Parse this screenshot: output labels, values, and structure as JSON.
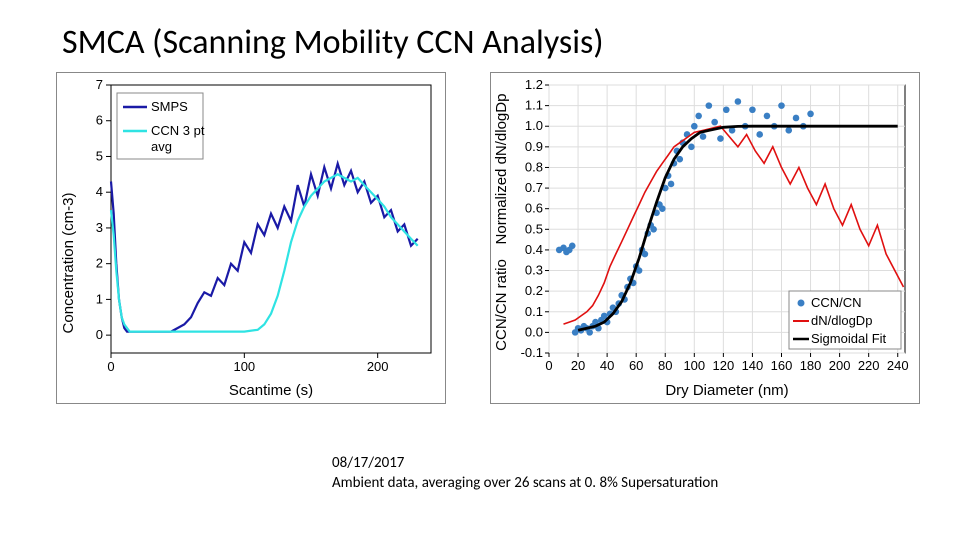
{
  "page_title": "SMCA (Scanning Mobility CCN Analysis)",
  "caption_line1": "08/17/2017",
  "caption_line2": "Ambient data, averaging over 26 scans at 0. 8% Supersaturation",
  "left_chart": {
    "xlabel": "Scantime (s)",
    "ylabel": "Concentration (cm-3)",
    "legend": {
      "s1": "SMPS",
      "s2": "CCN 3 pt",
      "s3": "avg"
    }
  },
  "right_chart": {
    "xlabel": "Dry Diameter (nm)",
    "ylabel_top": "Normalized dN/dlogDp",
    "ylabel_bot": "CCN/CN ratio",
    "legend": {
      "s1": "CCN/CN",
      "s2": "dN/dlogDp",
      "s3": "Sigmoidal Fit"
    }
  },
  "chart_data": [
    {
      "type": "line",
      "title": "",
      "xlabel": "Scantime (s)",
      "ylabel": "Concentration (cm-3)",
      "xlim": [
        0,
        240
      ],
      "ylim": [
        -0.5,
        7
      ],
      "xticks": [
        0,
        100,
        200
      ],
      "yticks": [
        0,
        1,
        2,
        3,
        4,
        5,
        6,
        7
      ],
      "series": [
        {
          "name": "SMPS",
          "color": "#1a1aa6",
          "x": [
            0,
            2,
            4,
            6,
            8,
            10,
            12,
            14,
            16,
            18,
            20,
            25,
            30,
            35,
            40,
            45,
            50,
            55,
            60,
            65,
            70,
            75,
            80,
            85,
            90,
            95,
            100,
            105,
            110,
            115,
            120,
            125,
            130,
            135,
            140,
            145,
            150,
            155,
            160,
            165,
            170,
            175,
            180,
            185,
            190,
            195,
            200,
            205,
            210,
            215,
            220,
            225,
            230
          ],
          "y": [
            4.3,
            3.4,
            2.0,
            1.0,
            0.5,
            0.2,
            0.1,
            0.1,
            0.1,
            0.1,
            0.1,
            0.1,
            0.1,
            0.1,
            0.1,
            0.1,
            0.2,
            0.3,
            0.5,
            0.9,
            1.2,
            1.1,
            1.6,
            1.4,
            2.0,
            1.8,
            2.6,
            2.3,
            3.1,
            2.8,
            3.4,
            3.0,
            3.6,
            3.2,
            4.2,
            3.6,
            4.5,
            3.9,
            4.7,
            4.1,
            4.8,
            4.2,
            4.6,
            4.0,
            4.3,
            3.7,
            3.9,
            3.3,
            3.5,
            2.9,
            3.1,
            2.5,
            2.7
          ]
        },
        {
          "name": "CCN 3 pt avg",
          "color": "#2fe3e3",
          "x": [
            0,
            2,
            4,
            6,
            8,
            10,
            12,
            14,
            16,
            18,
            20,
            30,
            40,
            50,
            60,
            70,
            80,
            90,
            100,
            110,
            115,
            120,
            125,
            130,
            135,
            140,
            145,
            150,
            155,
            160,
            165,
            170,
            175,
            180,
            185,
            190,
            195,
            200,
            205,
            210,
            215,
            220,
            225,
            230
          ],
          "y": [
            3.5,
            2.8,
            1.8,
            1.0,
            0.5,
            0.3,
            0.2,
            0.1,
            0.1,
            0.1,
            0.1,
            0.1,
            0.1,
            0.1,
            0.1,
            0.1,
            0.1,
            0.1,
            0.1,
            0.15,
            0.3,
            0.6,
            1.1,
            1.8,
            2.6,
            3.2,
            3.6,
            3.9,
            4.1,
            4.3,
            4.4,
            4.5,
            4.4,
            4.3,
            4.4,
            4.2,
            4.0,
            3.8,
            3.6,
            3.3,
            3.1,
            2.9,
            2.7,
            2.5
          ]
        }
      ]
    },
    {
      "type": "mixed",
      "title": "",
      "xlabel": "Dry Diameter (nm)",
      "ylabel": "Normalized dN/dlogDp ; CCN/CN ratio",
      "xlim": [
        0,
        245
      ],
      "ylim": [
        -0.1,
        1.2
      ],
      "xticks": [
        0,
        20,
        40,
        60,
        80,
        100,
        120,
        140,
        160,
        180,
        200,
        220,
        240
      ],
      "yticks": [
        -0.1,
        0,
        0.1,
        0.2,
        0.3,
        0.4,
        0.5,
        0.6,
        0.7,
        0.8,
        0.9,
        1.0,
        1.1,
        1.2
      ],
      "series": [
        {
          "name": "CCN/CN",
          "type": "scatter",
          "color": "#3a7fc4",
          "x": [
            7,
            10,
            12,
            14,
            16,
            18,
            20,
            22,
            24,
            26,
            28,
            30,
            32,
            34,
            36,
            38,
            40,
            42,
            44,
            46,
            48,
            50,
            52,
            54,
            56,
            58,
            60,
            62,
            64,
            66,
            68,
            70,
            72,
            74,
            76,
            78,
            80,
            82,
            84,
            86,
            88,
            90,
            92,
            95,
            98,
            100,
            103,
            106,
            110,
            114,
            118,
            122,
            126,
            130,
            135,
            140,
            145,
            150,
            155,
            160,
            165,
            170,
            175,
            180
          ],
          "y": [
            0.4,
            0.41,
            0.39,
            0.4,
            0.42,
            0.0,
            0.02,
            0.01,
            0.03,
            0.02,
            0.0,
            0.03,
            0.05,
            0.02,
            0.06,
            0.08,
            0.05,
            0.09,
            0.12,
            0.1,
            0.14,
            0.18,
            0.16,
            0.22,
            0.26,
            0.24,
            0.32,
            0.3,
            0.4,
            0.38,
            0.48,
            0.52,
            0.5,
            0.58,
            0.62,
            0.6,
            0.7,
            0.76,
            0.72,
            0.82,
            0.88,
            0.84,
            0.92,
            0.96,
            0.9,
            1.0,
            1.05,
            0.95,
            1.1,
            1.02,
            0.94,
            1.08,
            0.98,
            1.12,
            1.0,
            1.08,
            0.96,
            1.05,
            1.0,
            1.1,
            0.98,
            1.04,
            1.0,
            1.06
          ]
        },
        {
          "name": "dN/dlogDp",
          "type": "line",
          "color": "#e01010",
          "x": [
            10,
            14,
            18,
            22,
            26,
            30,
            34,
            38,
            42,
            46,
            50,
            54,
            58,
            62,
            66,
            70,
            74,
            78,
            82,
            86,
            90,
            94,
            100,
            106,
            112,
            118,
            124,
            130,
            136,
            142,
            148,
            154,
            160,
            166,
            172,
            178,
            184,
            190,
            196,
            202,
            208,
            214,
            220,
            226,
            232,
            238,
            244
          ],
          "y": [
            0.04,
            0.05,
            0.06,
            0.08,
            0.1,
            0.13,
            0.18,
            0.24,
            0.32,
            0.38,
            0.44,
            0.5,
            0.56,
            0.62,
            0.68,
            0.73,
            0.78,
            0.82,
            0.86,
            0.9,
            0.92,
            0.94,
            0.97,
            0.98,
            0.99,
            1.0,
            0.95,
            0.9,
            0.96,
            0.88,
            0.82,
            0.9,
            0.8,
            0.72,
            0.8,
            0.7,
            0.62,
            0.72,
            0.6,
            0.52,
            0.62,
            0.5,
            0.42,
            0.52,
            0.38,
            0.3,
            0.22
          ]
        },
        {
          "name": "Sigmoidal Fit",
          "type": "line",
          "color": "#000000",
          "x": [
            20,
            26,
            32,
            38,
            44,
            50,
            56,
            62,
            68,
            74,
            80,
            86,
            92,
            98,
            104,
            110,
            120,
            130,
            140,
            150,
            160,
            170,
            180,
            200,
            220,
            240
          ],
          "y": [
            0.01,
            0.02,
            0.03,
            0.05,
            0.09,
            0.15,
            0.24,
            0.36,
            0.5,
            0.63,
            0.75,
            0.84,
            0.9,
            0.94,
            0.97,
            0.98,
            0.995,
            0.999,
            1.0,
            1.0,
            1.0,
            1.0,
            1.0,
            1.0,
            1.0,
            1.0
          ]
        }
      ]
    }
  ]
}
